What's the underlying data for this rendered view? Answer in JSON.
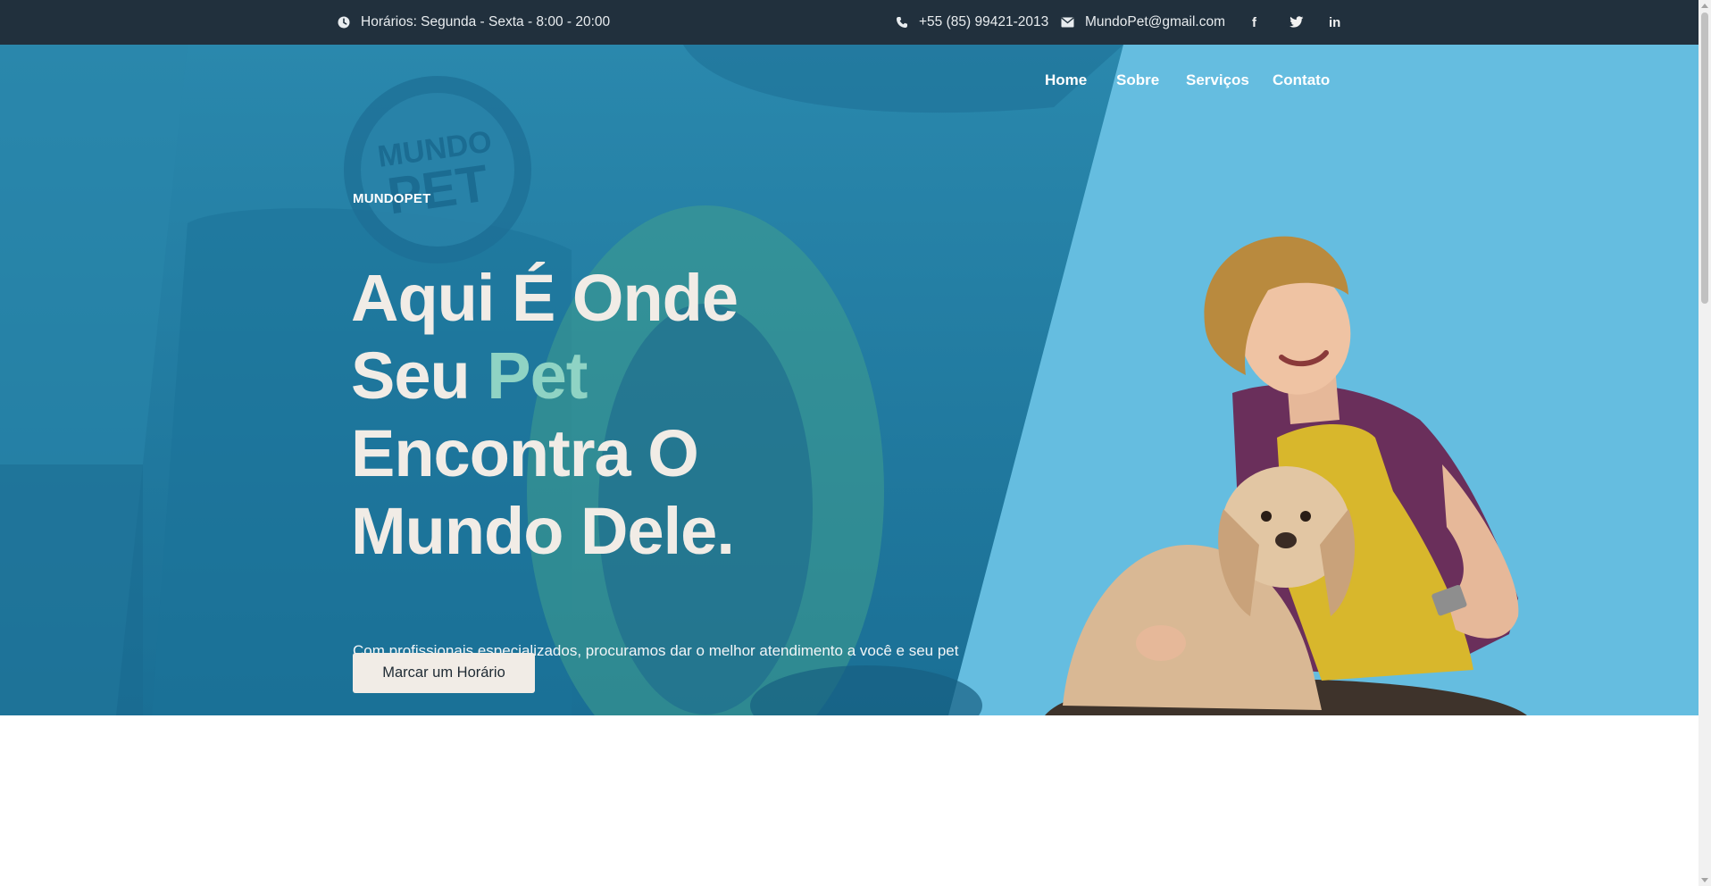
{
  "topbar": {
    "hours": "Horários: Segunda - Sexta - 8:00 - 20:00",
    "phone": "+55 (85) 99421-2013",
    "email": "MundoPet@gmail.com",
    "social": {
      "facebook": "f",
      "linkedin": "in"
    },
    "icons": [
      "clock-icon",
      "phone-icon",
      "envelope-icon",
      "facebook-icon",
      "twitter-icon",
      "linkedin-icon"
    ]
  },
  "nav": {
    "items": [
      {
        "label": "Home"
      },
      {
        "label": "Sobre"
      },
      {
        "label": "Serviços"
      },
      {
        "label": "Contato"
      }
    ]
  },
  "hero": {
    "brand": "MUNDOPET",
    "headline": {
      "line1": "Aqui É Onde",
      "line2_start": "Seu ",
      "line2_accent": "Pet",
      "line3": "Encontra O",
      "line4": "Mundo Dele."
    },
    "subtext": "Com profissionais especializados, procuramos dar o melhor atendimento a você e seu pet",
    "cta_label": "Marcar um Horário",
    "storefront_sign": "MUNDO PET"
  },
  "colors": {
    "topbar_bg": "#21303d",
    "hero_left_overlay": "#1b7ea3",
    "hero_right_bg": "#65bde0",
    "accent_green": "#8fd3c4",
    "headline_text": "#f1ece6",
    "cta_bg": "#f1ece6"
  }
}
